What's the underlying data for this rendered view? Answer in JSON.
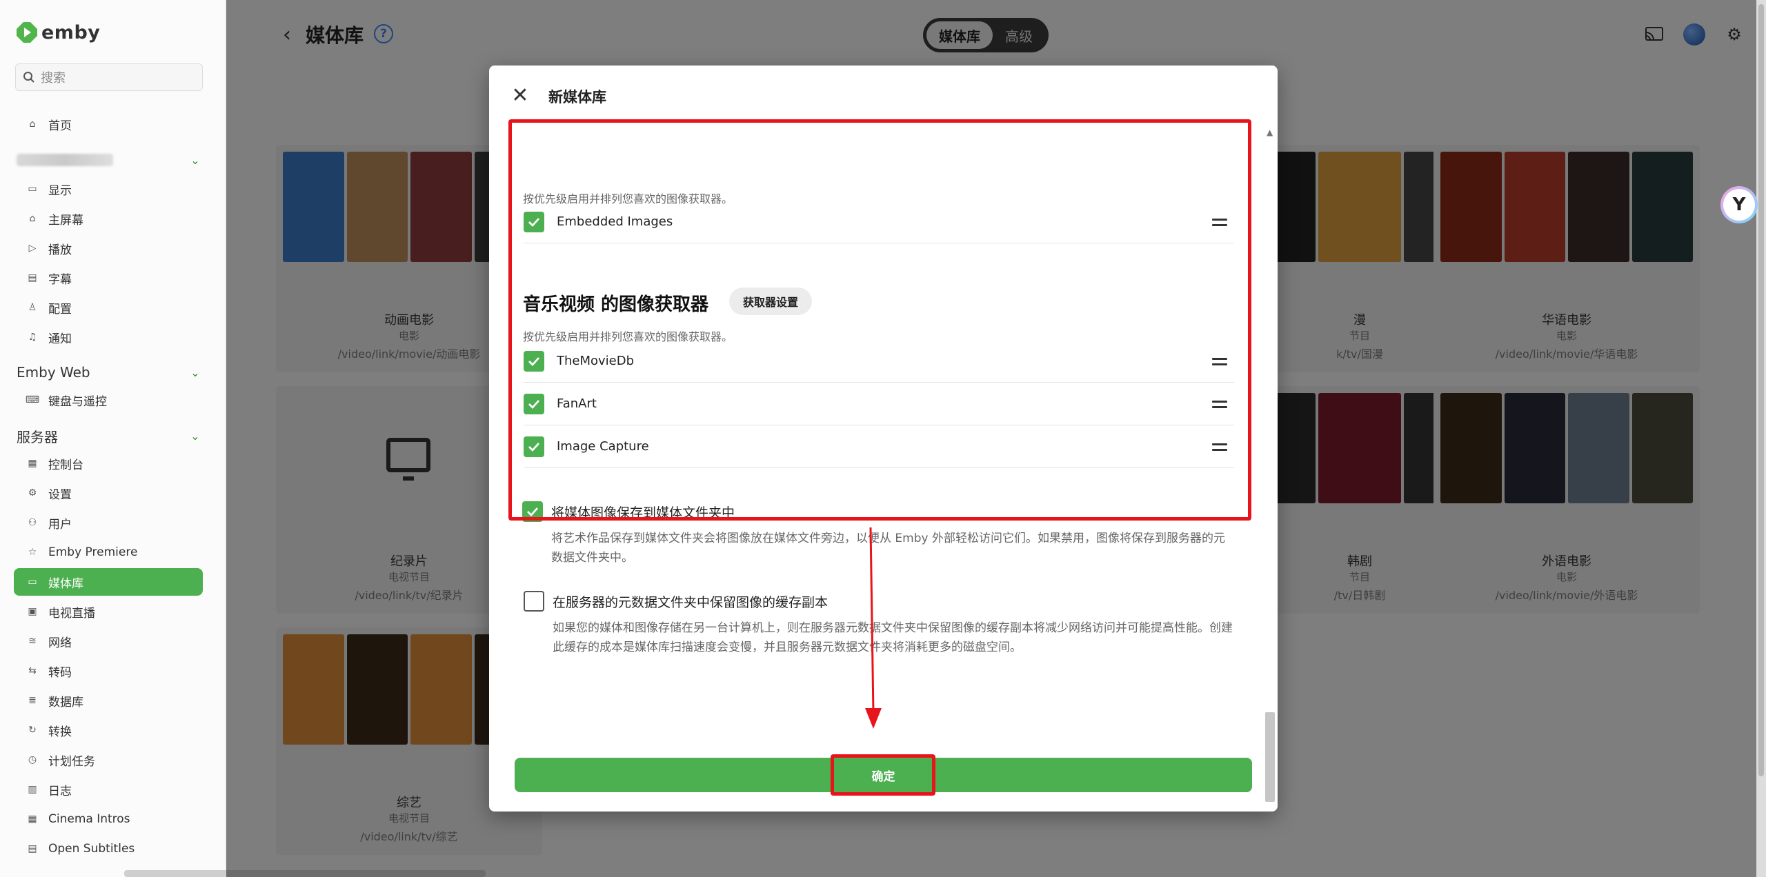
{
  "app": {
    "logo_text": "emby"
  },
  "sidebar": {
    "search_placeholder": "搜索",
    "home": "首页",
    "user_group": [
      {
        "label": "显示",
        "icon": "display-icon"
      },
      {
        "label": "主屏幕",
        "icon": "home-icon"
      },
      {
        "label": "播放",
        "icon": "play-icon"
      },
      {
        "label": "字幕",
        "icon": "subtitles-icon"
      },
      {
        "label": "配置",
        "icon": "profile-icon"
      },
      {
        "label": "通知",
        "icon": "bell-icon"
      }
    ],
    "emby_web_header": "Emby Web",
    "emby_web_items": [
      {
        "label": "键盘与遥控",
        "icon": "keyboard-icon"
      }
    ],
    "server_header": "服务器",
    "server_items": [
      {
        "label": "控制台",
        "icon": "dashboard-icon"
      },
      {
        "label": "设置",
        "icon": "gear-icon"
      },
      {
        "label": "用户",
        "icon": "users-icon"
      },
      {
        "label": "Emby Premiere",
        "icon": "star-icon"
      },
      {
        "label": "媒体库",
        "icon": "folder-icon"
      },
      {
        "label": "电视直播",
        "icon": "tv-icon"
      },
      {
        "label": "网络",
        "icon": "wifi-icon"
      },
      {
        "label": "转码",
        "icon": "transcode-icon"
      },
      {
        "label": "数据库",
        "icon": "database-icon"
      },
      {
        "label": "转换",
        "icon": "convert-icon"
      },
      {
        "label": "计划任务",
        "icon": "clock-icon"
      },
      {
        "label": "日志",
        "icon": "log-icon"
      },
      {
        "label": "Cinema Intros",
        "icon": "film-icon"
      },
      {
        "label": "Open Subtitles",
        "icon": "subtitles-icon"
      }
    ]
  },
  "header": {
    "title": "媒体库",
    "tabs": [
      {
        "label": "媒体库",
        "active": true
      },
      {
        "label": "高级",
        "active": false
      }
    ]
  },
  "libraries": [
    {
      "name": "动画电影",
      "type": "电影",
      "path": "/video/link/movie/动画电影"
    },
    {
      "name": "漫",
      "type": "节目",
      "path": "k/tv/国漫"
    },
    {
      "name": "华语电影",
      "type": "电影",
      "path": "/video/link/movie/华语电影"
    },
    {
      "name": "纪录片",
      "type": "电视节目",
      "path": "/video/link/tv/纪录片"
    },
    {
      "name": "韩剧",
      "type": "节目",
      "path": "/tv/日韩剧"
    },
    {
      "name": "外语电影",
      "type": "电影",
      "path": "/video/link/movie/外语电影"
    },
    {
      "name": "综艺",
      "type": "电视节目",
      "path": "/video/link/tv/综艺"
    }
  ],
  "dialog": {
    "title": "新媒体库",
    "top_hint": "按优先级启用并排列您喜欢的图像获取器。",
    "top_fetchers": [
      {
        "name": "Embedded Images",
        "checked": true
      }
    ],
    "music_section_title": "音乐视频 的图像获取器",
    "fetcher_settings_button": "获取器设置",
    "music_hint": "按优先级启用并排列您喜欢的图像获取器。",
    "music_fetchers": [
      {
        "name": "TheMovieDb",
        "checked": true
      },
      {
        "name": "FanArt",
        "checked": true
      },
      {
        "name": "Image Capture",
        "checked": true
      }
    ],
    "save_to_media": {
      "label": "将媒体图像保存到媒体文件夹中",
      "checked": true,
      "desc": "将艺术作品保存到媒体文件夹会将图像放在媒体文件旁边，以便从 Emby 外部轻松访问它们。如果禁用，图像将保存到服务器的元数据文件夹中。"
    },
    "cache_copy": {
      "label": "在服务器的元数据文件夹中保留图像的缓存副本",
      "checked": false,
      "desc": "如果您的媒体和图像存储在另一台计算机上，则在服务器元数据文件夹中保留图像的缓存副本将减少网络访问并可能提高性能。创建此缓存的成本是媒体库扫描速度会变慢，并且服务器元数据文件夹将消耗更多的磁盘空间。"
    },
    "confirm_label": "确定"
  },
  "colors": {
    "accent": "#4caf50",
    "annotation": "#e8141c"
  }
}
